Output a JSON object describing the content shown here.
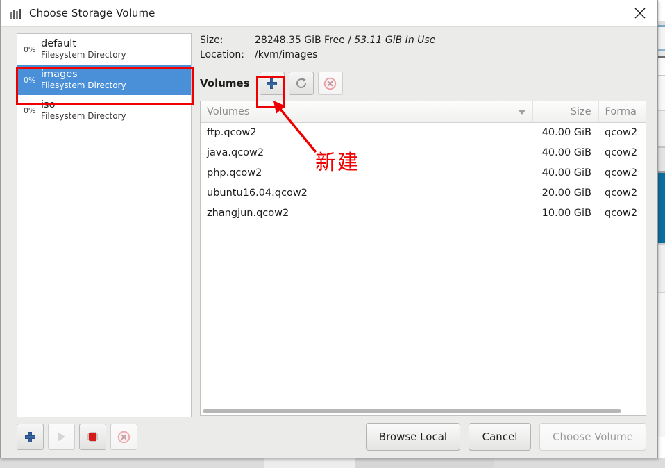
{
  "window": {
    "title": "Choose Storage Volume",
    "icon": "storage-pool-icon",
    "close_label": "×"
  },
  "pools": {
    "items": [
      {
        "percent": "0%",
        "name": "default",
        "type": "Filesystem Directory",
        "selected": false
      },
      {
        "percent": "0%",
        "name": "images",
        "type": "Filesystem Directory",
        "selected": true
      },
      {
        "percent": "0%",
        "name": "iso",
        "type": "Filesystem Directory",
        "selected": false
      }
    ]
  },
  "details": {
    "size_label": "Size:",
    "size_free": "28248.35 GiB Free / ",
    "size_inuse": "53.11 GiB In Use",
    "location_label": "Location:",
    "location_value": "/kvm/images"
  },
  "volumes_toolbar": {
    "label": "Volumes",
    "new_volume_icon": "plus-icon",
    "refresh_icon": "refresh-icon",
    "delete_icon": "delete-circle-icon"
  },
  "table": {
    "columns": [
      "Volumes",
      "Size",
      "Forma"
    ],
    "sort_indicator": "sort-descending-caret",
    "rows": [
      {
        "name": "ftp.qcow2",
        "size": "40.00 GiB",
        "format": "qcow2"
      },
      {
        "name": "java.qcow2",
        "size": "40.00 GiB",
        "format": "qcow2"
      },
      {
        "name": "php.qcow2",
        "size": "40.00 GiB",
        "format": "qcow2"
      },
      {
        "name": "ubuntu16.04.qcow2",
        "size": "20.00 GiB",
        "format": "qcow2"
      },
      {
        "name": "zhangjun.qcow2",
        "size": "10.00 GiB",
        "format": "qcow2"
      }
    ]
  },
  "pool_toolbar": {
    "add_icon": "plus-icon",
    "start_icon": "play-icon",
    "stop_icon": "stop-octagon-icon",
    "delete_icon": "delete-circle-icon"
  },
  "footer": {
    "browse_local": "Browse Local",
    "cancel": "Cancel",
    "choose_volume": "Choose Volume"
  },
  "annotations": {
    "callout_text": "新建",
    "color": "#ef0000"
  }
}
